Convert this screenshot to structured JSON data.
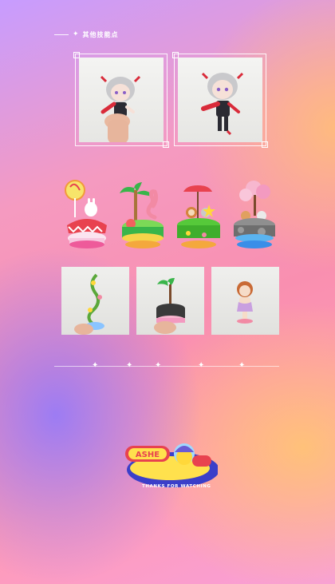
{
  "section": {
    "title": "其他技能点"
  },
  "gallery": {
    "figurine_photos": [
      {
        "icon": "doll-figure-hand-photo"
      },
      {
        "icon": "doll-figure-photo"
      }
    ],
    "cake_figures": [
      {
        "icon": "candy-picnic-cake-icon"
      },
      {
        "icon": "palm-flamingo-cake-icon"
      },
      {
        "icon": "umbrella-garden-cake-icon"
      },
      {
        "icon": "sakura-rock-cake-icon"
      }
    ],
    "small_photos": [
      {
        "icon": "vine-tower-photo"
      },
      {
        "icon": "plant-cake-photo"
      },
      {
        "icon": "girl-figure-photo"
      }
    ]
  },
  "footer": {
    "logo_text": "ASHE",
    "thanks_text": "THANKS FOR WATCHING"
  },
  "colors": {
    "accent": "#ffffff",
    "logo_blue": "#3b3fc9",
    "logo_yellow": "#ffe14d",
    "logo_red": "#e8424f"
  }
}
